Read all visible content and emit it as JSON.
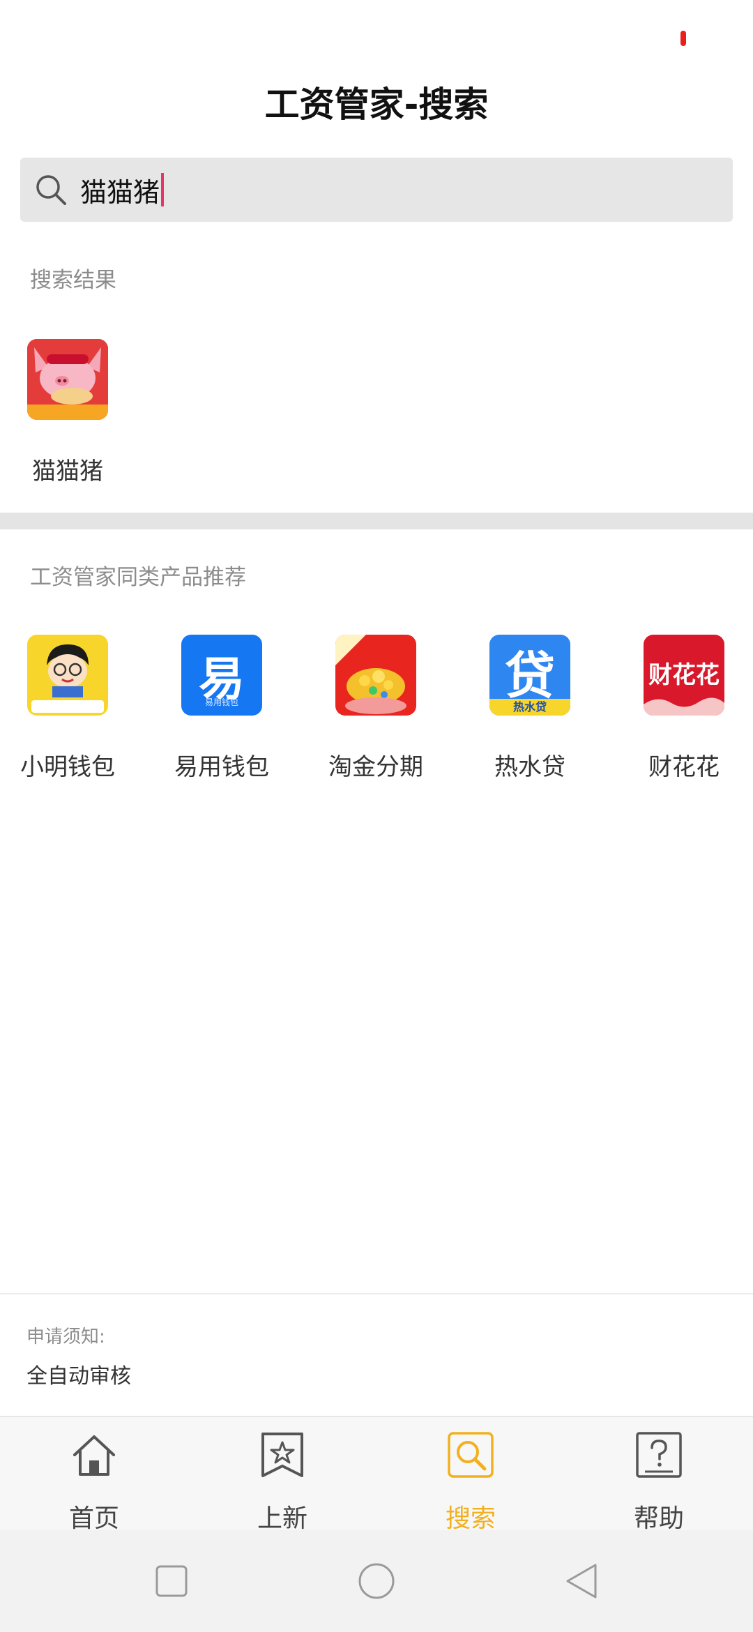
{
  "header": {
    "title": "工资管家-搜索"
  },
  "search": {
    "value": "猫猫猪"
  },
  "results": {
    "label": "搜索结果",
    "items": [
      {
        "name": "猫猫猪",
        "icon": "cat-pig-app-icon",
        "icon_caption": "猫猫猪"
      }
    ]
  },
  "recommend": {
    "label": "工资管家同类产品推荐",
    "items": [
      {
        "name": "小明钱包",
        "icon": "xiaoming-wallet-app-icon",
        "icon_caption": "小明钱包"
      },
      {
        "name": "易用钱包",
        "icon": "yiyong-wallet-app-icon",
        "icon_glyph": "易",
        "icon_caption": "易用钱包"
      },
      {
        "name": "淘金分期",
        "icon": "taojin-installment-app-icon",
        "icon_caption": "淘金分期"
      },
      {
        "name": "热水贷",
        "icon": "reshui-loan-app-icon",
        "icon_glyph": "贷",
        "icon_caption": "热水贷"
      },
      {
        "name": "财花花",
        "icon": "caihuahua-app-icon",
        "icon_glyph": "财花花"
      }
    ]
  },
  "notice": {
    "label": "申请须知:",
    "value": "全自动审核"
  },
  "tabbar": {
    "tabs": [
      {
        "label": "首页",
        "icon": "home-icon"
      },
      {
        "label": "上新",
        "icon": "bookmark-star-icon"
      },
      {
        "label": "搜索",
        "icon": "search-icon",
        "active": true
      },
      {
        "label": "帮助",
        "icon": "help-icon"
      }
    ]
  },
  "colors": {
    "accent": "#f2b01e",
    "caret": "#e8336b",
    "status_dot": "#e8201c"
  }
}
